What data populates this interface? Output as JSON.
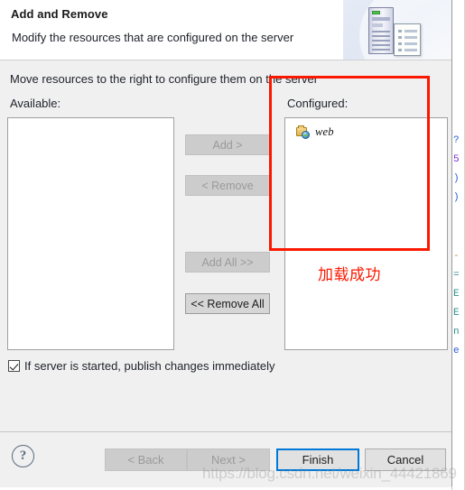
{
  "dialog": {
    "title": "Add and Remove",
    "subtitle": "Modify the resources that are configured on the server",
    "instruction": "Move resources to the right to configure them on the server",
    "available_label": "Available:",
    "configured_label": "Configured:",
    "available_items": [],
    "configured_items": [
      {
        "label": "web",
        "icon": "web-module-icon"
      }
    ],
    "transfer_buttons": [
      {
        "label": "Add >",
        "enabled": false,
        "name": "add-button"
      },
      {
        "label": "< Remove",
        "enabled": false,
        "name": "remove-button"
      },
      {
        "label": "Add All >>",
        "enabled": false,
        "name": "add-all-button"
      },
      {
        "label": "<< Remove All",
        "enabled": true,
        "name": "remove-all-button"
      }
    ],
    "publish_checkbox": {
      "label": "If server is started, publish changes immediately",
      "checked": true
    },
    "footer_buttons": [
      {
        "label": "< Back",
        "state": "disabled",
        "name": "back-button"
      },
      {
        "label": "Next >",
        "state": "disabled",
        "name": "next-button"
      },
      {
        "label": "Finish",
        "state": "default",
        "name": "finish-button"
      },
      {
        "label": "Cancel",
        "state": "enabled",
        "name": "cancel-button"
      }
    ],
    "help_glyph": "?"
  },
  "annotation": {
    "note_text": "加载成功",
    "color": "#fb1800"
  },
  "watermark": {
    "text": "https://blog.csdn.net/weixin_44421869"
  },
  "background": {
    "code_fragments": [
      "?",
      "5",
      ")",
      ")",
      "-",
      "=",
      "E",
      "E",
      "n",
      "e"
    ]
  }
}
